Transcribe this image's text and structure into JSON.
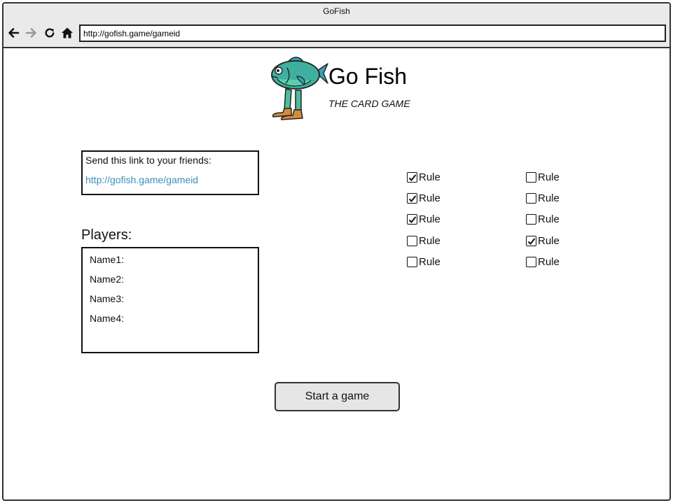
{
  "window": {
    "title": "GoFish"
  },
  "browser": {
    "address": "http://gofish.game/gameid",
    "icons": [
      "back-arrow-icon",
      "forward-arrow-icon",
      "reload-icon",
      "home-icon"
    ]
  },
  "header": {
    "title": "Go Fish",
    "subtitle": "THE CARD GAME",
    "logo": "fish-mascot-logo"
  },
  "invite": {
    "label": "Send this link to your friends:",
    "link": "http://gofish.game/gameid",
    "link_color": "#3b8fb8"
  },
  "players": {
    "heading": "Players:",
    "names": [
      "Name1:",
      "Name2:",
      "Name3:",
      "Name4:"
    ]
  },
  "rules": {
    "left_column": [
      {
        "label": "Rule",
        "checked": true
      },
      {
        "label": "Rule",
        "checked": true
      },
      {
        "label": "Rule",
        "checked": true
      },
      {
        "label": "Rule",
        "checked": false
      },
      {
        "label": "Rule",
        "checked": false
      }
    ],
    "right_column": [
      {
        "label": "Rule",
        "checked": false
      },
      {
        "label": "Rule",
        "checked": false
      },
      {
        "label": "Rule",
        "checked": false
      },
      {
        "label": "Rule",
        "checked": true
      },
      {
        "label": "Rule",
        "checked": false
      }
    ]
  },
  "actions": {
    "start_label": "Start a game"
  }
}
